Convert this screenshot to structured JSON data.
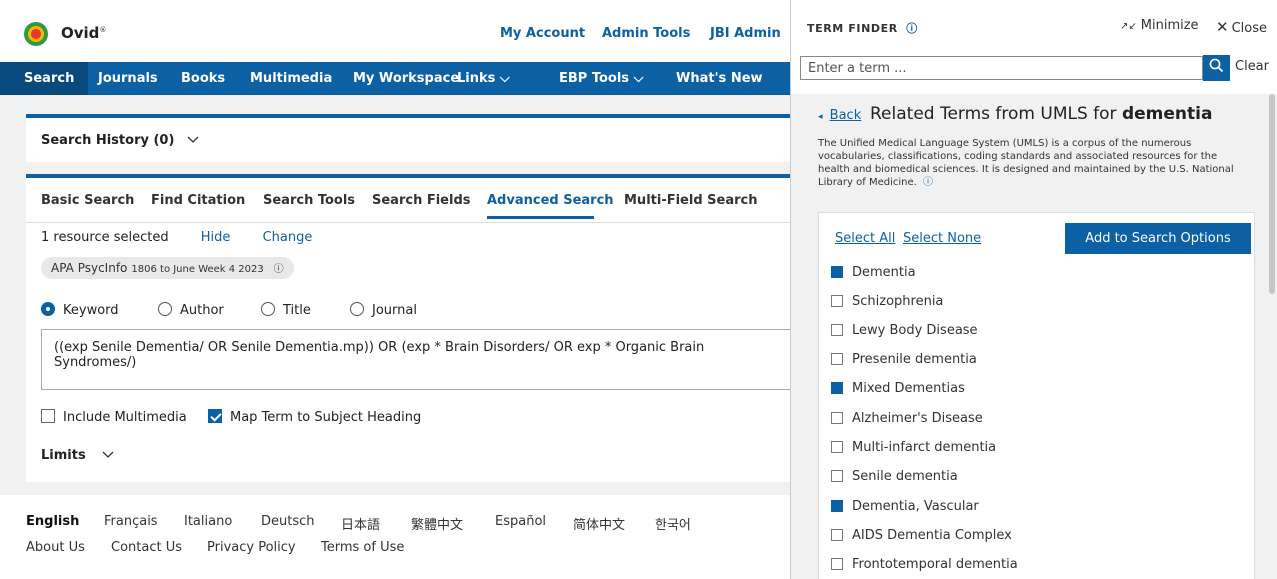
{
  "header": {
    "brand": "Ovid",
    "brand_sup": "®",
    "links": [
      "My Account",
      "Admin Tools",
      "JBI Admin"
    ]
  },
  "nav": {
    "items": [
      "Search",
      "Journals",
      "Books",
      "Multimedia",
      "My Workspace",
      "Links ⌵",
      "EBP Tools ⌵",
      "What's New"
    ]
  },
  "history": {
    "label": "Search History (0)"
  },
  "tabs": [
    "Basic Search",
    "Find Citation",
    "Search Tools",
    "Search Fields",
    "Advanced Search",
    "Multi-Field Search"
  ],
  "active_tab": "Advanced Search",
  "resource": {
    "selected_text": "1 resource selected",
    "hide": "Hide",
    "change": "Change",
    "badge_name": "APA PsycInfo",
    "badge_range": "1806 to June Week 4 2023"
  },
  "search_mode": {
    "options": [
      "Keyword",
      "Author",
      "Title",
      "Journal"
    ],
    "selected": "Keyword"
  },
  "query": "((exp Senile Dementia/ OR Senile Dementia.mp)) OR (exp * Brain Disorders/ OR exp * Organic Brain Syndromes/)",
  "checkboxes": {
    "include_multimedia": {
      "label": "Include Multimedia",
      "checked": false
    },
    "map_term": {
      "label": "Map Term to Subject Heading",
      "checked": true
    }
  },
  "limits": "Limits",
  "footer": {
    "languages": [
      "English",
      "Français",
      "Italiano",
      "Deutsch",
      "日本語",
      "繁體中文",
      "Español",
      "简体中文",
      "한국어"
    ],
    "active_language": "English",
    "links": [
      "About Us",
      "Contact Us",
      "Privacy Policy",
      "Terms of Use"
    ]
  },
  "finder": {
    "title": "TERM FINDER",
    "minimize": "Minimize",
    "close": "Close",
    "placeholder": "Enter a term ...",
    "clear": "Clear",
    "back": "Back",
    "related_prefix": "Related Terms from UMLS for",
    "related_term": "dementia",
    "description": "The Unified Medical Language System (UMLS) is a corpus of the numerous vocabularies, classifications, coding standards and associated resources for the health and biomedical sciences. It is designed and maintained by the U.S. National Library of Medicine.",
    "select_all": "Select All",
    "select_none": "Select None",
    "add_button": "Add to Search Options",
    "terms": [
      {
        "label": "Dementia",
        "checked": true
      },
      {
        "label": "Schizophrenia",
        "checked": false
      },
      {
        "label": "Lewy Body Disease",
        "checked": false
      },
      {
        "label": "Presenile dementia",
        "checked": false
      },
      {
        "label": "Mixed Dementias",
        "checked": true
      },
      {
        "label": "Alzheimer's Disease",
        "checked": false
      },
      {
        "label": "Multi-infarct dementia",
        "checked": false
      },
      {
        "label": "Senile dementia",
        "checked": false
      },
      {
        "label": "Dementia, Vascular",
        "checked": true
      },
      {
        "label": "AIDS Dementia Complex",
        "checked": false
      },
      {
        "label": "Frontotemporal dementia",
        "checked": false
      }
    ]
  },
  "colors": {
    "accent": "#0b61a4",
    "background": "#f1f1f1"
  }
}
